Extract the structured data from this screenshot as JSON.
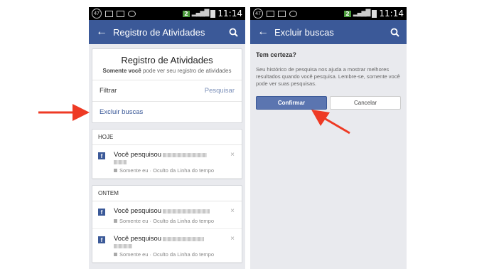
{
  "colors": {
    "facebook_blue": "#3b5998",
    "annotation_arrow": "#ee3a24"
  },
  "status_bar": {
    "badge": "47",
    "signal_badge": "2",
    "time": "11:14"
  },
  "left_screen": {
    "app_bar": {
      "back_icon": "arrow-left",
      "title": "Registro de Atividades",
      "search_icon": "magnifier"
    },
    "header_card": {
      "title": "Registro de Atividades",
      "subtitle_bold": "Somente você",
      "subtitle_rest": " pode ver seu registro de atividades"
    },
    "filter_row": {
      "label": "Filtrar",
      "action": "Pesquisar"
    },
    "clear_row": {
      "label": "Excluir buscas"
    },
    "sections": [
      {
        "heading": "HOJE",
        "entries": [
          {
            "text": "Você pesquisou",
            "meta": "Somente eu · Oculto da Linha do tempo",
            "close": "×"
          }
        ]
      },
      {
        "heading": "ONTEM",
        "entries": [
          {
            "text": "Você pesquisou",
            "meta": "Somente eu · Oculto da Linha do tempo",
            "close": "×"
          },
          {
            "text": "Você pesquisou",
            "meta": "Somente eu · Oculto da Linha do tempo",
            "close": "×"
          }
        ]
      }
    ]
  },
  "right_screen": {
    "app_bar": {
      "back_icon": "arrow-left",
      "title": "Excluir buscas",
      "search_icon": "magnifier"
    },
    "dialog": {
      "title": "Tem certeza?",
      "text": "Seu histórico de pesquisa nos ajuda a mostrar melhores resultados quando você pesquisa. Lembre-se, somente você pode ver suas pesquisas.",
      "confirm_label": "Confirmar",
      "cancel_label": "Cancelar"
    }
  }
}
